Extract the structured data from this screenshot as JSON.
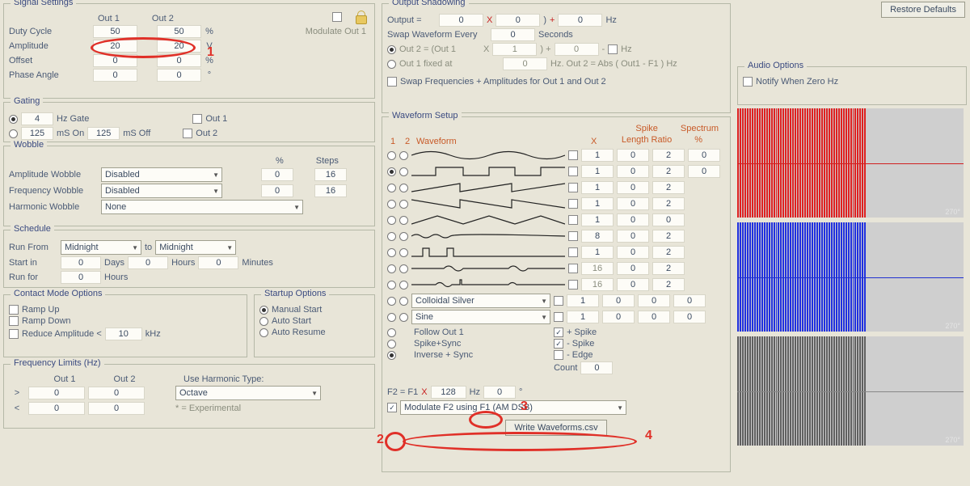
{
  "restore_defaults": "Restore Defaults",
  "signal": {
    "title": "Signal Settings",
    "out1": "Out 1",
    "out2": "Out 2",
    "rows": [
      {
        "label": "Duty Cycle",
        "v1": "50",
        "v2": "50",
        "unit": "%"
      },
      {
        "label": "Amplitude",
        "v1": "20",
        "v2": "20",
        "unit": "V"
      },
      {
        "label": "Offset",
        "v1": "0",
        "v2": "0",
        "unit": "%"
      },
      {
        "label": "Phase Angle",
        "v1": "0",
        "v2": "0",
        "unit": "°"
      }
    ],
    "modulate_out1": "Modulate Out 1"
  },
  "gating": {
    "title": "Gating",
    "hz_gate_val": "4",
    "hz_gate_lbl": "Hz Gate",
    "ms_on_val": "125",
    "ms_on_lbl": "mS On",
    "ms_off_val": "125",
    "ms_off_lbl": "mS Off",
    "out1": "Out 1",
    "out2": "Out 2"
  },
  "wobble": {
    "title": "Wobble",
    "pct": "%",
    "steps": "Steps",
    "rows": [
      {
        "label": "Amplitude Wobble",
        "sel": "Disabled",
        "pct": "0",
        "steps": "16"
      },
      {
        "label": "Frequency Wobble",
        "sel": "Disabled",
        "pct": "0",
        "steps": "16"
      }
    ],
    "harmonic_label": "Harmonic Wobble",
    "harmonic_sel": "None"
  },
  "schedule": {
    "title": "Schedule",
    "run_from": "Run From",
    "midnight": "Midnight",
    "to": "to",
    "start_in": "Start in",
    "run_for": "Run for",
    "days": "Days",
    "hours": "Hours",
    "minutes": "Minutes",
    "zero": "0"
  },
  "contact": {
    "title": "Contact Mode Options",
    "ramp_up": "Ramp Up",
    "ramp_down": "Ramp Down",
    "reduce_amp": "Reduce Amplitude <",
    "reduce_val": "10",
    "khz": "kHz"
  },
  "startup": {
    "title": "Startup Options",
    "manual": "Manual Start",
    "auto_start": "Auto Start",
    "auto_resume": "Auto Resume"
  },
  "freq_limits": {
    "title": "Frequency Limits (Hz)",
    "out1": "Out 1",
    "out2": "Out 2",
    "gt": ">",
    "lt": "<",
    "zero": "0",
    "use_type": "Use Harmonic Type:",
    "sel": "Octave",
    "exp": "* = Experimental"
  },
  "shadow": {
    "title": "Output Shadowing",
    "output_eq": "Output =",
    "x": "X",
    "plus": "+",
    "hz": "Hz",
    "swap_every": "Swap Waveform Every",
    "seconds": "Seconds",
    "out2_eq": "Out 2 = (Out 1",
    "mult": "X",
    "rp_plus": ")  +",
    "dash": "-",
    "out1_fixed": "Out 1 fixed at",
    "abs_lbl": "Hz. Out 2 = Abs ( Out1 - F1 ) Hz",
    "swap_freqs": "Swap Frequencies + Amplitudes for Out 1 and Out 2",
    "v_output": "0",
    "v_mult": "0",
    "v_add": "0",
    "v_swap": "0",
    "v_o2mult": "1",
    "v_o2add": "0",
    "v_fixed": "0"
  },
  "waveform": {
    "title": "Waveform Setup",
    "spike": "Spike",
    "length_ratio": "Length Ratio",
    "spectrum": "Spectrum",
    "pct": "%",
    "h1": "1",
    "h2": "2",
    "hw": "Waveform",
    "hX": "X",
    "rows": [
      {
        "x": "1",
        "a": "0",
        "b": "2",
        "c": "0"
      },
      {
        "x": "1",
        "a": "0",
        "b": "2",
        "c": "0"
      },
      {
        "x": "1",
        "a": "0",
        "b": "2",
        "c": ""
      },
      {
        "x": "1",
        "a": "0",
        "b": "2",
        "c": ""
      },
      {
        "x": "1",
        "a": "0",
        "b": "0",
        "c": ""
      },
      {
        "x": "8",
        "a": "0",
        "b": "2",
        "c": ""
      },
      {
        "x": "1",
        "a": "0",
        "b": "2",
        "c": ""
      },
      {
        "x": "16",
        "a": "0",
        "b": "2",
        "c": ""
      },
      {
        "x": "16",
        "a": "0",
        "b": "2",
        "c": ""
      }
    ],
    "sel1": "Colloidal Silver",
    "sel1_vals": {
      "x": "1",
      "a": "0",
      "b": "0",
      "c": "0"
    },
    "sel2": "Sine",
    "sel2_vals": {
      "x": "1",
      "a": "0",
      "b": "0",
      "c": "0"
    },
    "follow": "Follow Out 1",
    "spike_sync": "Spike+Sync",
    "inverse_sync": "Inverse + Sync",
    "plus_spike": "+ Spike",
    "minus_spike": "- Spike",
    "minus_edge": "- Edge",
    "count": "Count",
    "count_val": "0",
    "f2_eq": "F2 = F1",
    "f2_x": "X",
    "f2_val": "128",
    "f2_hz": "Hz",
    "f2_deg_val": "0",
    "f2_deg": "°",
    "modulate_sel": "Modulate F2 using F1 (AM DSB)",
    "write_csv": "Write Waveforms.csv"
  },
  "audio": {
    "title": "Audio Options",
    "notify": "Notify When Zero Hz"
  },
  "annotations": {
    "n1": "1",
    "n2": "2",
    "n3": "3",
    "n4": "4"
  }
}
